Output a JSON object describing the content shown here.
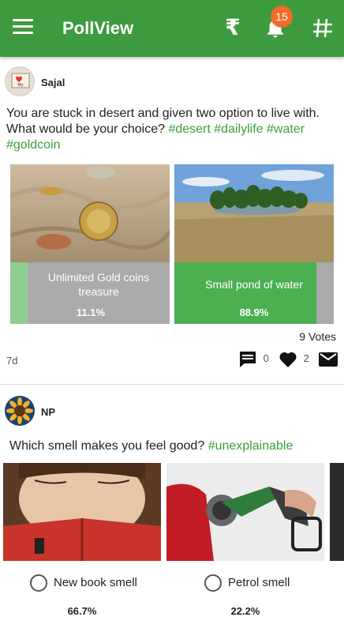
{
  "app": {
    "title": "PollView",
    "notification_count": "15"
  },
  "colors": {
    "primary": "#3e9a3f",
    "badge": "#f26b2a",
    "bar_gray": "#aaaaaa",
    "bar_green": "#4caf50"
  },
  "icons": [
    "menu-icon",
    "rupee-icon",
    "bell-icon",
    "hashtag-icon",
    "comment-icon",
    "heart-icon",
    "mail-icon"
  ],
  "posts": [
    {
      "username": "Sajal",
      "question_text": "You are stuck in desert and given two option to live with. What would be your choice?",
      "hashtags": [
        "#desert",
        "#dailylife",
        "#water",
        "#goldcoin"
      ],
      "options": [
        {
          "label": "Unlimited Gold coins treasure",
          "percent": "11.1%",
          "fraction": 0.111
        },
        {
          "label": "Small pond of water",
          "percent": "88.9%",
          "fraction": 0.889
        }
      ],
      "votes": "9 Votes",
      "age": "7d",
      "comments": "0",
      "likes": "2"
    },
    {
      "username": "NP",
      "question_text": "Which smell makes you feel good?",
      "hashtags": [
        "#unexplainable"
      ],
      "options": [
        {
          "label": "New book smell",
          "percent": "66.7%"
        },
        {
          "label": "Petrol smell",
          "percent": "22.2%"
        }
      ]
    }
  ]
}
